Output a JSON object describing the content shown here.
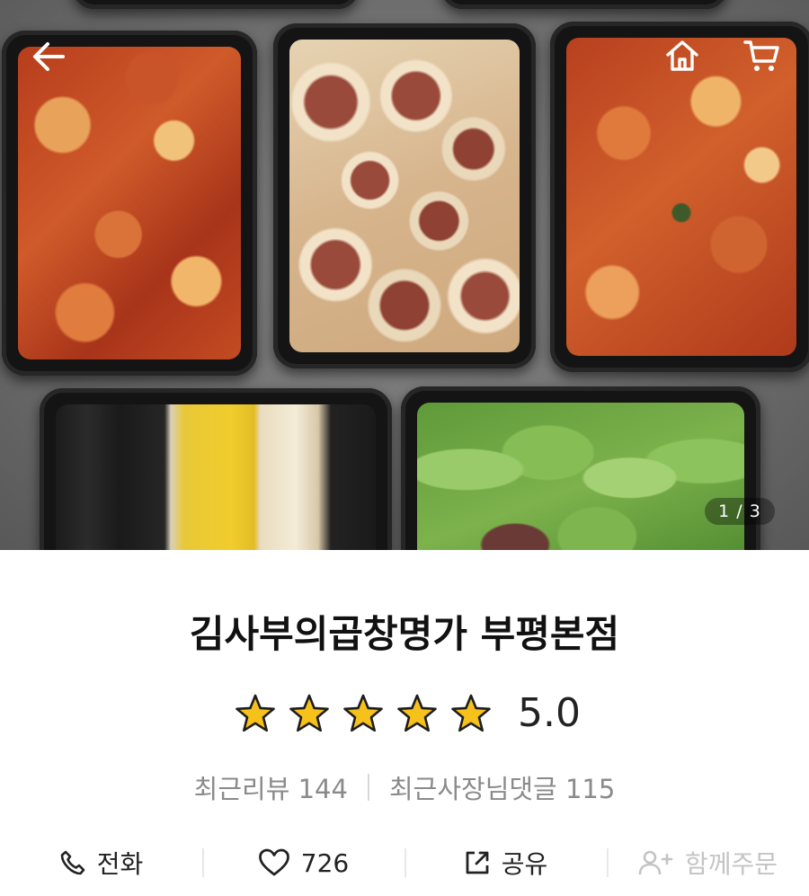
{
  "store": {
    "name": "김사부의곱창명가 부평본점",
    "rating": "5.0",
    "stars": 5,
    "recent_reviews": "최근리뷰 144",
    "recent_owner_comments": "최근사장님댓글 115"
  },
  "gallery": {
    "indicator": "1 / 3"
  },
  "header": {
    "back_icon": "arrow-left-icon",
    "home_icon": "home-icon",
    "cart_icon": "cart-icon"
  },
  "actions": [
    {
      "label": "전화",
      "icon": "phone-icon"
    },
    {
      "label": "726",
      "icon": "heart-icon"
    },
    {
      "label": "공유",
      "icon": "share-icon"
    },
    {
      "label": "함께주문",
      "icon": "add-user-icon",
      "disabled": true
    }
  ],
  "colors": {
    "star": "#f7c11c",
    "text": "#222222",
    "muted": "#8a8a8a",
    "disabled": "#c4c4c4"
  }
}
